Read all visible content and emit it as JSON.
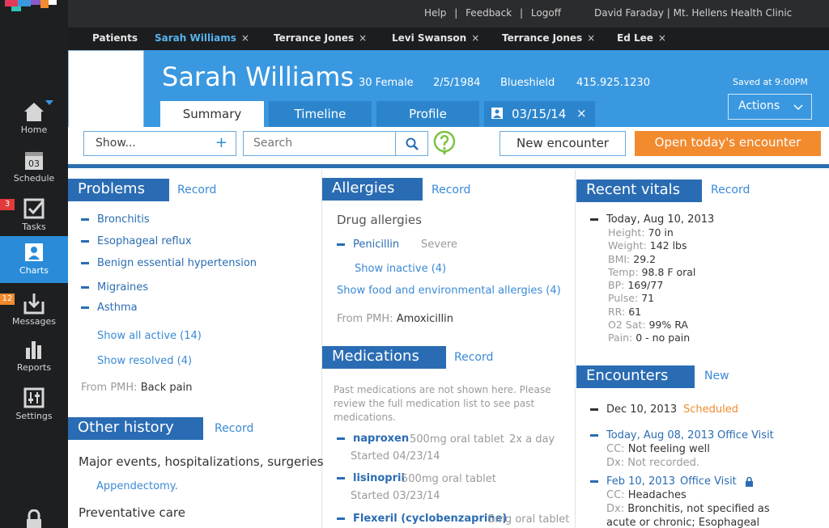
{
  "topbar": {
    "help": "Help",
    "sep1": "|",
    "feedback": "Feedback",
    "sep2": "|",
    "logoff": "Logoff",
    "user": "David Faraday | Mt. Hellens Health Clinic"
  },
  "leftnav": {
    "items": [
      {
        "label": "Home",
        "icon": "home-icon"
      },
      {
        "label": "Schedule",
        "icon": "calendar-icon",
        "icon_text": "03"
      },
      {
        "label": "Tasks",
        "icon": "checkbox-icon",
        "badge": "3"
      },
      {
        "label": "Charts",
        "icon": "person-icon"
      },
      {
        "label": "Messages",
        "icon": "inbox-icon",
        "badge": "12"
      },
      {
        "label": "Reports",
        "icon": "bar-chart-icon"
      },
      {
        "label": "Settings",
        "icon": "sliders-icon"
      }
    ]
  },
  "patient_tabs": [
    {
      "label": "Patients"
    },
    {
      "label": "Sarah Williams",
      "close": "×"
    },
    {
      "label": "Terrance Jones",
      "close": "×"
    },
    {
      "label": "Levi Swanson",
      "close": "×"
    },
    {
      "label": "Terrance Jones",
      "close": "×"
    },
    {
      "label": "Ed Lee",
      "close": "×"
    }
  ],
  "patient": {
    "name": "Sarah Williams",
    "age_sex": "30 Female",
    "dob": "2/5/1984",
    "insurance": "Blueshield",
    "phone": "415.925.1230",
    "saved": "Saved at 9:00PM"
  },
  "header_tabs": {
    "summary": "Summary",
    "timeline": "Timeline",
    "profile": "Profile",
    "encounter_date": "03/15/14",
    "encounter_close": "×",
    "actions": "Actions"
  },
  "toolbar": {
    "show": "Show...",
    "show_plus": "+",
    "search_placeholder": "Search",
    "new_encounter": "New encounter",
    "open_encounter": "Open today's encounter"
  },
  "problems": {
    "title": "Problems",
    "record": "Record",
    "items": [
      "Bronchitis",
      "Esophageal reflux",
      "Benign essential hypertension",
      "Migraines",
      "Asthma"
    ],
    "show_all": "Show all active (14)",
    "show_resolved": "Show resolved (4)",
    "pmh_label": "From PMH:",
    "pmh_value": "Back pain"
  },
  "other_history": {
    "title": "Other history",
    "record": "Record",
    "major_events": "Major events, hospitalizations, surgeries",
    "appendectomy": "Appendectomy.",
    "preventative": "Preventative care"
  },
  "allergies": {
    "title": "Allergies",
    "record": "Record",
    "drug": "Drug allergies",
    "item": "Penicillin",
    "severity": "Severe",
    "show_inactive": "Show inactive (4)",
    "show_food": "Show food and environmental allergies (4)",
    "pmh_label": "From PMH:",
    "pmh_value": "Amoxicillin"
  },
  "medications": {
    "title": "Medications",
    "record": "Record",
    "note": [
      "Past medications are not shown here. Please",
      "review the full medication list to see past",
      "medications."
    ],
    "items": [
      {
        "name": "naproxen",
        "dose": "500mg oral tablet",
        "freq": "2x a day",
        "started": "Started 04/23/14"
      },
      {
        "name": "lisinopril",
        "dose": "500mg oral tablet",
        "freq": "",
        "started": "Started 03/23/14"
      },
      {
        "name": "Flexeril (cyclobenzaprine)",
        "dose": "5mg  oral tablet",
        "freq": "",
        "started": ""
      }
    ]
  },
  "vitals": {
    "title": "Recent vitals",
    "record": "Record",
    "date": "Today, Aug 10, 2013",
    "rows": [
      {
        "label": "Height:",
        "value": "70 in"
      },
      {
        "label": "Weight:",
        "value": "142 lbs"
      },
      {
        "label": "BMI:",
        "value": "29.2"
      },
      {
        "label": "Temp:",
        "value": "98.8 F oral"
      },
      {
        "label": "BP:",
        "value": "169/77"
      },
      {
        "label": "Pulse:",
        "value": "71"
      },
      {
        "label": "RR:",
        "value": "61"
      },
      {
        "label": "O2 Sat:",
        "value": " 99% RA"
      },
      {
        "label": "Pain:",
        "value": "0 - no pain"
      }
    ]
  },
  "encounters": {
    "title": "Encounters",
    "new": "New",
    "items": [
      {
        "date": "Dec 10, 2013",
        "status": "Scheduled"
      },
      {
        "date": "Today, Aug 08, 2013",
        "type": "Office Visit",
        "cc_label": "CC:",
        "cc": "Not feeling well",
        "dx_label": "Dx:",
        "dx": "Not recorded."
      },
      {
        "date": "Feb 10, 2013",
        "type": "Office Visit",
        "cc_label": "CC:",
        "cc": "Headaches",
        "dx_label": "Dx:",
        "dx": "Bronchitis, not specified as",
        "dx2": "acute or chronic; Esophageal"
      }
    ]
  },
  "colors": {
    "header_blue": "#3a98e0",
    "section_blue": "#2a6cb3",
    "link_blue": "#3a8ad6",
    "orange": "#f28a2e",
    "nav_dark": "#1e1f21"
  }
}
